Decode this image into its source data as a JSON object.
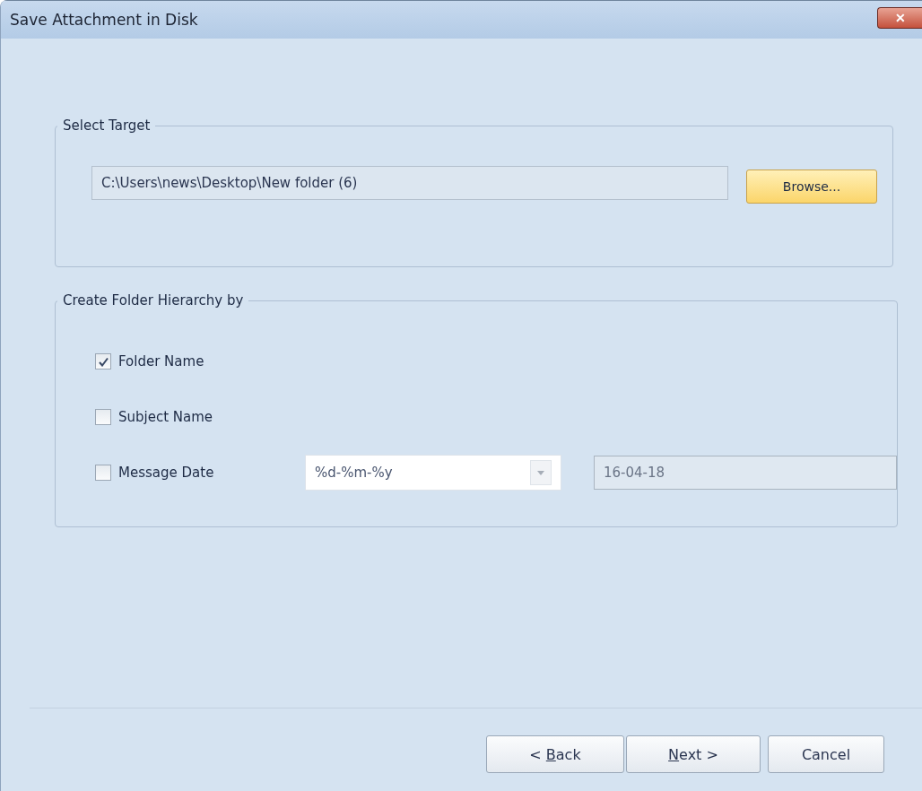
{
  "window": {
    "title": "Save Attachment in Disk",
    "close": "✕"
  },
  "select_target": {
    "legend": "Select Target",
    "path": "C:\\Users\\news\\Desktop\\New folder (6)",
    "browse": "Browse..."
  },
  "hierarchy": {
    "legend": "Create Folder Hierarchy by",
    "options": [
      {
        "label": "Folder Name",
        "checked": true
      },
      {
        "label": "Subject Name",
        "checked": false
      },
      {
        "label": "Message Date",
        "checked": false
      }
    ],
    "date_format": "%d-%m-%y",
    "date_preview": "16-04-18"
  },
  "buttons": [
    {
      "before": "< ",
      "key": "B",
      "after": "ack"
    },
    {
      "key": "N",
      "after": "ext >"
    },
    {
      "label": "Cancel"
    }
  ]
}
